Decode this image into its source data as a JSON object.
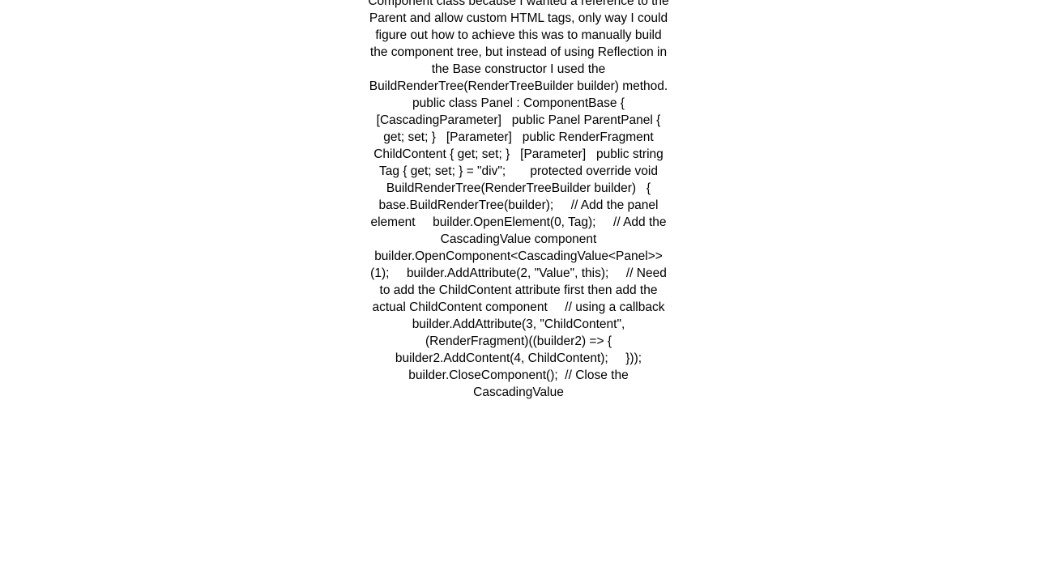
{
  "page": {
    "background_color": "#ffffff",
    "text_color": "#000000"
  },
  "content": {
    "block_name": "code-answer-text",
    "alignment": "center",
    "body": "Component class because I wanted a reference to the Parent and allow custom HTML tags, only way I could figure out how to achieve this was to manually build the component tree, but instead of using Reflection in the Base constructor I used the BuildRenderTree(RenderTreeBuilder builder) method. public class Panel : ComponentBase {   [CascadingParameter]   public Panel ParentPanel { get; set; }   [Parameter]   public RenderFragment ChildContent { get; set; }   [Parameter]   public string Tag { get; set; } = \"div\";       protected override void BuildRenderTree(RenderTreeBuilder builder)   {     base.BuildRenderTree(builder);     // Add the panel element     builder.OpenElement(0, Tag);     // Add the CascadingValue component     builder.OpenComponent<CascadingValue<Panel>>(1);     builder.AddAttribute(2, \"Value\", this);     // Need to add the ChildContent attribute first then add the actual ChildContent component     // using a callback     builder.AddAttribute(3, \"ChildContent\", (RenderFragment)((builder2) => {       builder2.AddContent(4, ChildContent);     }));     builder.CloseComponent();  // Close the CascadingValue"
  }
}
